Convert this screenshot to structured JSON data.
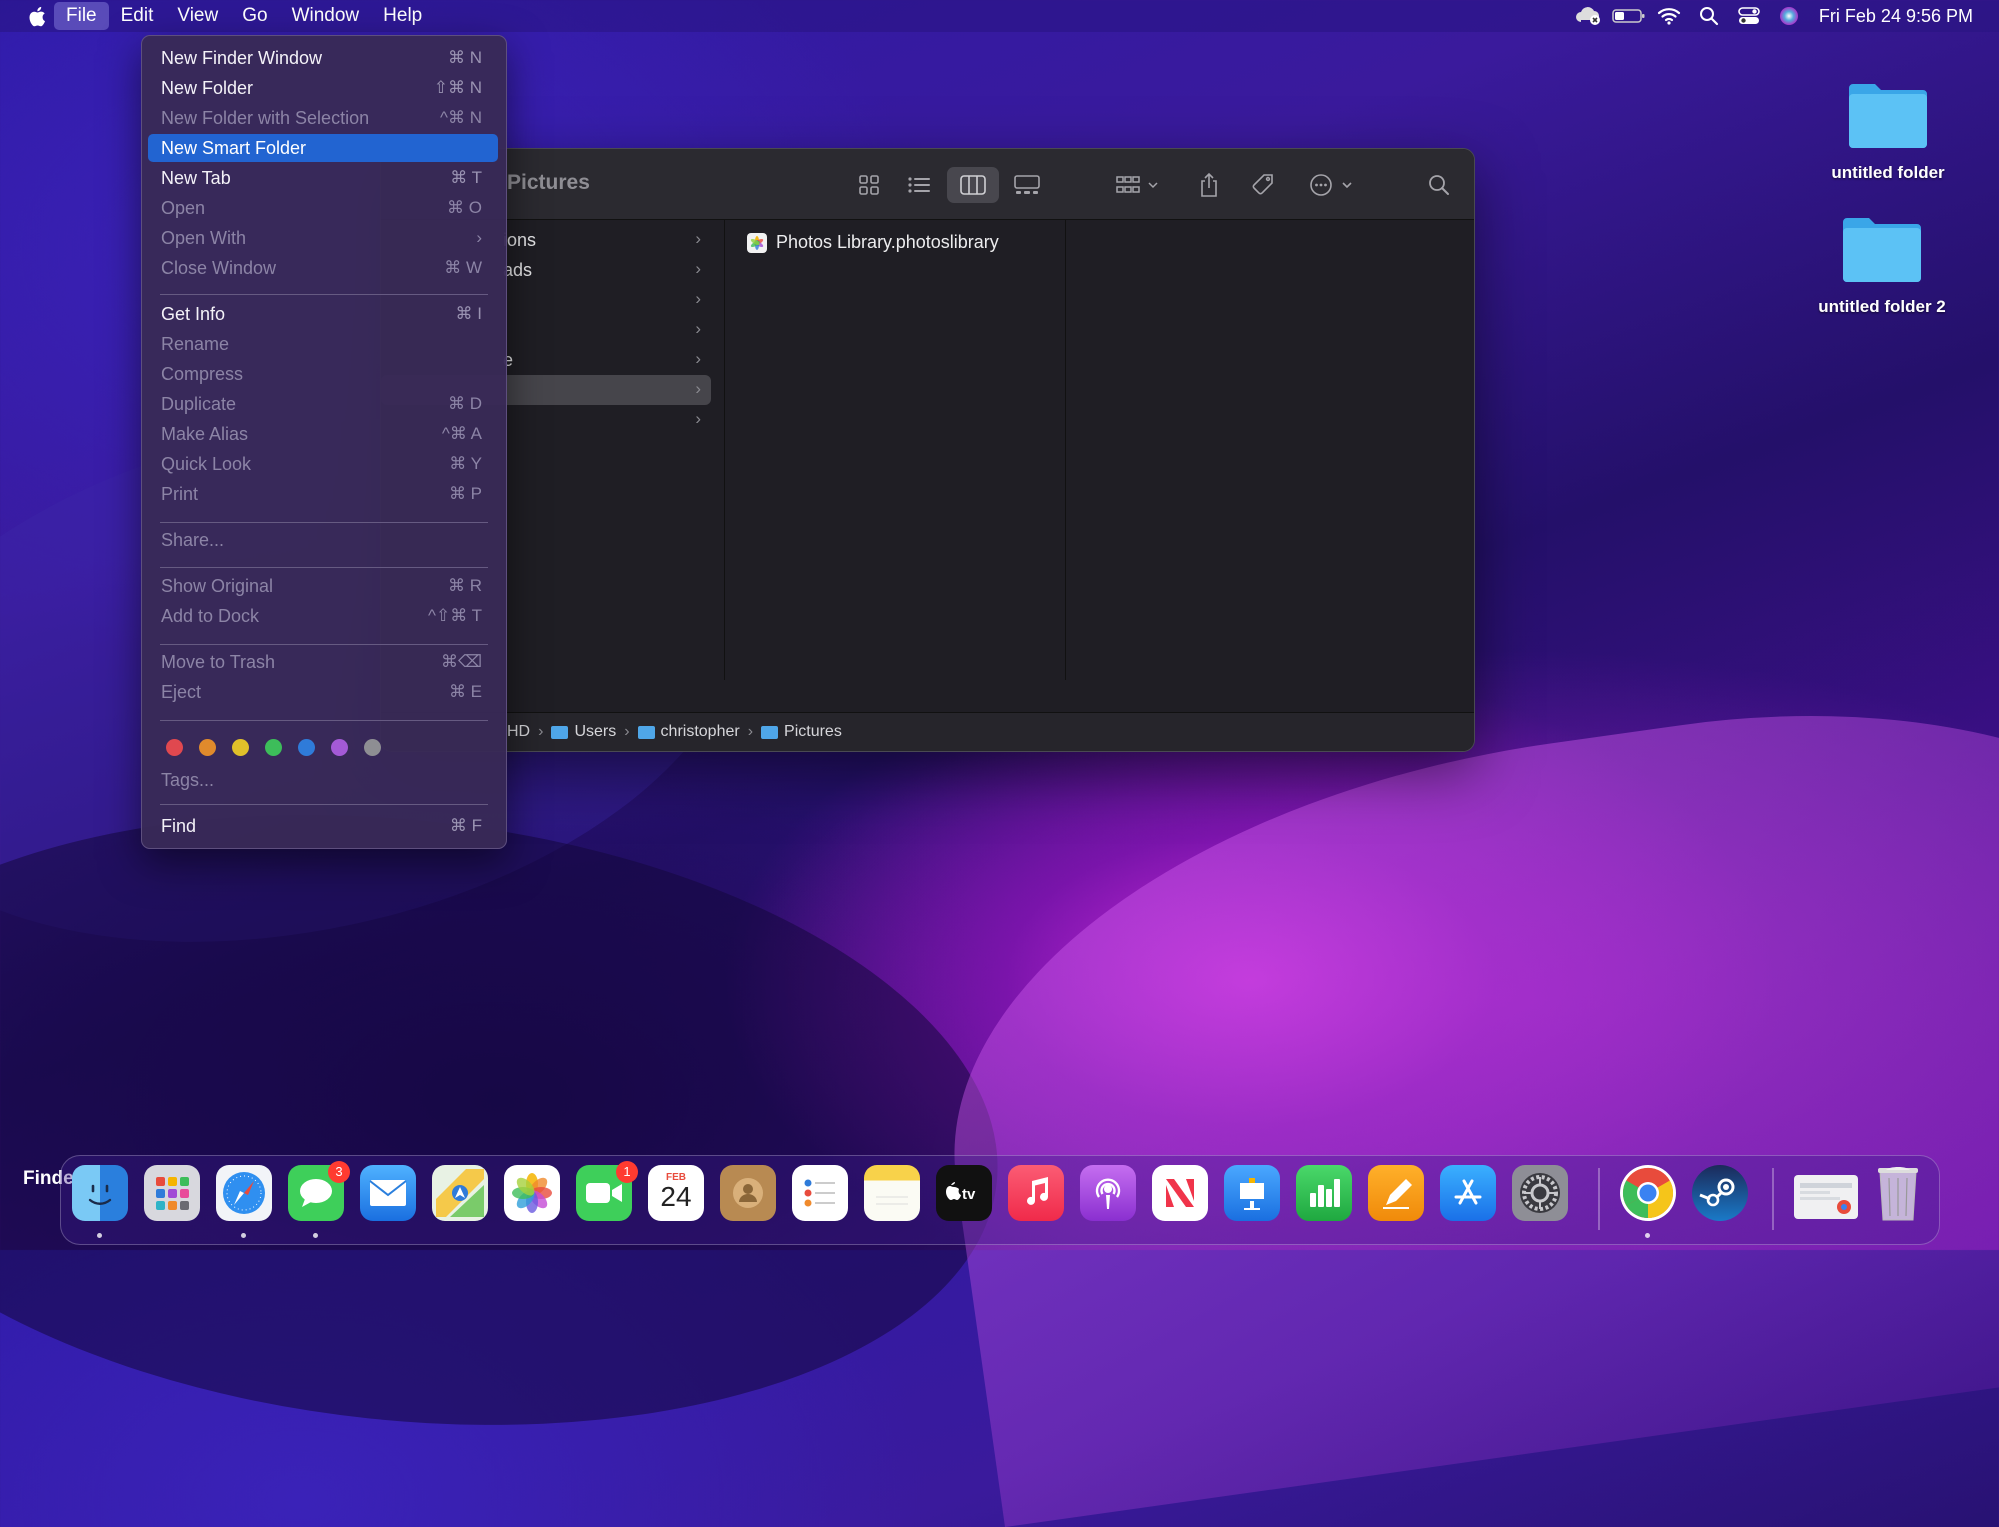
{
  "menubar": {
    "app_name": "Finder",
    "menus": [
      "File",
      "Edit",
      "View",
      "Go",
      "Window",
      "Help"
    ],
    "active_menu": "File",
    "clock": "Fri Feb 24  9:56 PM",
    "status_icons": [
      "icloud-sync-icon",
      "battery-icon",
      "wifi-icon",
      "spotlight-search-icon",
      "control-center-icon",
      "siri-icon"
    ]
  },
  "file_menu": {
    "items": [
      {
        "label": "New Finder Window",
        "shortcut": "⌘ N",
        "enabled": true
      },
      {
        "label": "New Folder",
        "shortcut": "⇧⌘ N",
        "enabled": true
      },
      {
        "label": "New Folder with Selection",
        "shortcut": "^⌘ N",
        "enabled": false
      },
      {
        "label": "New Smart Folder",
        "shortcut": "",
        "enabled": true,
        "highlighted": true
      },
      {
        "label": "New Tab",
        "shortcut": "⌘ T",
        "enabled": true
      },
      {
        "label": "Open",
        "shortcut": "⌘ O",
        "enabled": false
      },
      {
        "label": "Open With",
        "shortcut": "›",
        "enabled": false
      },
      {
        "label": "Close Window",
        "shortcut": "⌘ W",
        "enabled": false
      },
      {
        "label": "Get Info",
        "shortcut": "⌘ I",
        "enabled": true
      },
      {
        "label": "Rename",
        "shortcut": "",
        "enabled": false
      },
      {
        "label": "Compress",
        "shortcut": "",
        "enabled": false
      },
      {
        "label": "Duplicate",
        "shortcut": "⌘ D",
        "enabled": false
      },
      {
        "label": "Make Alias",
        "shortcut": "^⌘ A",
        "enabled": false
      },
      {
        "label": "Quick Look",
        "shortcut": "⌘ Y",
        "enabled": false
      },
      {
        "label": "Print",
        "shortcut": "⌘ P",
        "enabled": false
      },
      {
        "label": "Share...",
        "shortcut": "",
        "enabled": false
      },
      {
        "label": "Show Original",
        "shortcut": "⌘ R",
        "enabled": false
      },
      {
        "label": "Add to Dock",
        "shortcut": "^⇧⌘ T",
        "enabled": false
      },
      {
        "label": "Move to Trash",
        "shortcut": "⌘⌫",
        "enabled": false
      },
      {
        "label": "Eject",
        "shortcut": "⌘ E",
        "enabled": false
      },
      {
        "label": "Tags...",
        "shortcut": "",
        "enabled": false
      },
      {
        "label": "Find",
        "shortcut": "⌘ F",
        "enabled": true
      }
    ],
    "tag_colors": [
      "#e0484f",
      "#e08a2c",
      "#e0c02a",
      "#3dbd5a",
      "#2f7bd9",
      "#a45ad6",
      "#8e8e93"
    ]
  },
  "finder": {
    "title": "Pictures",
    "sidebar_rows": [
      "ions",
      "ads",
      "",
      "",
      "e",
      "",
      ""
    ],
    "files": [
      "Photos Library.photoslibrary"
    ],
    "path": [
      "HD",
      "Users",
      "christopher",
      "Pictures"
    ]
  },
  "desktop": {
    "icons": [
      "untitled folder",
      "untitled folder 2"
    ]
  },
  "dock": {
    "apps": [
      "Finder",
      "Launchpad",
      "Safari",
      "Messages",
      "Mail",
      "Maps",
      "Photos",
      "FaceTime",
      "Calendar",
      "Contacts",
      "Reminders",
      "Notes",
      "TV",
      "Music",
      "Podcasts",
      "News",
      "Keynote",
      "Numbers",
      "Pages",
      "App Store",
      "System Settings",
      "Chrome",
      "Steam",
      "Downloads",
      "Trash"
    ],
    "badges": {
      "messages": "3",
      "facetime": "1"
    },
    "calendar": {
      "month": "FEB",
      "day": "24"
    }
  }
}
